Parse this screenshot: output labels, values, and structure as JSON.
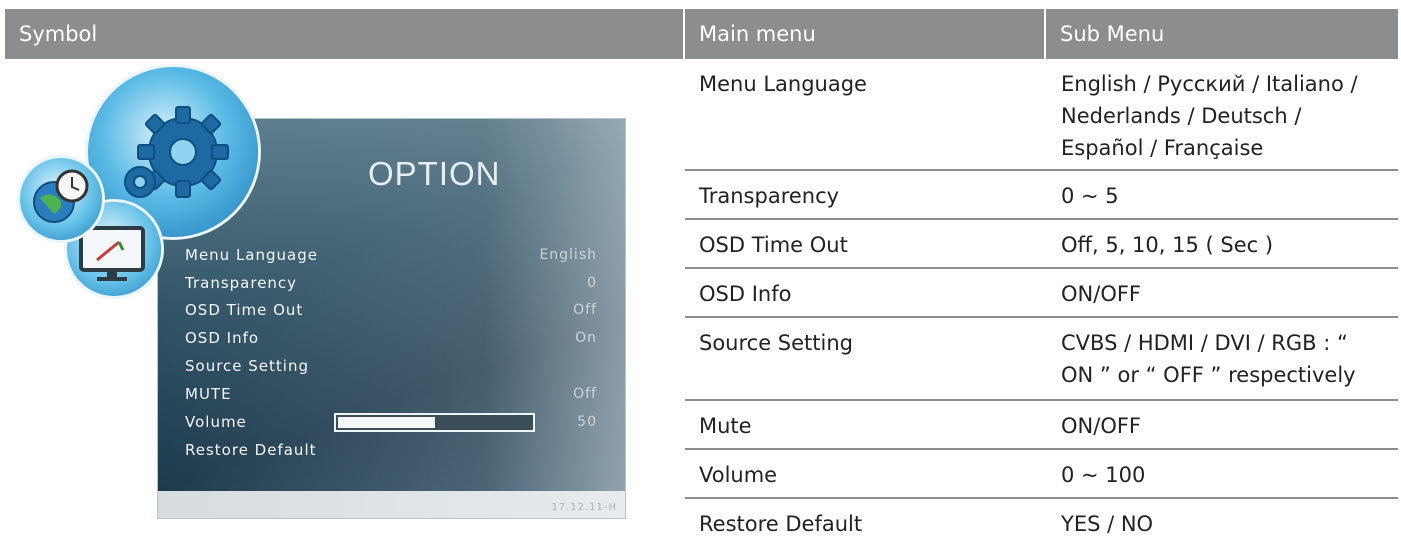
{
  "header": {
    "symbol": "Symbol",
    "main_menu": "Main menu",
    "sub_menu": "Sub Menu"
  },
  "rows": [
    {
      "main": "Menu Language",
      "sub": "English / Русский / Italiano / Nederlands / Deutsch / Español / Française"
    },
    {
      "main": "Transparency",
      "sub": "0 ~ 5"
    },
    {
      "main": "OSD Time Out",
      "sub": "Off, 5, 10, 15 ( Sec )"
    },
    {
      "main": "OSD Info",
      "sub": "ON/OFF"
    },
    {
      "main": "Source Setting",
      "sub": "CVBS / HDMI / DVI / RGB : “ ON ” or “ OFF ” respectively"
    },
    {
      "main": "Mute",
      "sub": "ON/OFF"
    },
    {
      "main": "Volume",
      "sub": "0 ~ 100"
    },
    {
      "main": "Restore Default",
      "sub": "YES / NO"
    }
  ],
  "osd": {
    "title": "OPTION",
    "items": [
      {
        "label": "Menu Language",
        "value": "English"
      },
      {
        "label": "Transparency",
        "value": "0"
      },
      {
        "label": "OSD Time Out",
        "value": "Off"
      },
      {
        "label": "OSD Info",
        "value": "On"
      },
      {
        "label": "Source Setting",
        "value": ""
      },
      {
        "label": "MUTE",
        "value": "Off"
      },
      {
        "label": "Volume",
        "value": "50"
      },
      {
        "label": "Restore Default",
        "value": ""
      }
    ],
    "volume_level": 0.5,
    "footer": "17.12.11-H"
  },
  "icons": [
    "gear-icon",
    "globe-clock-icon",
    "monitor-icon"
  ],
  "colors": {
    "header_bg": "#8b8d8f",
    "divider": "#8b8d8f",
    "osd_bg": "#2f5366"
  }
}
